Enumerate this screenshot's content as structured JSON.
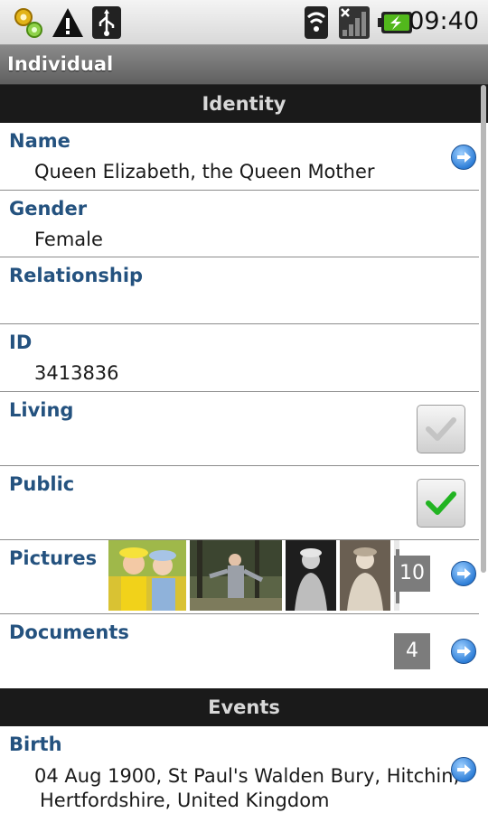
{
  "status_bar": {
    "time": "09:40",
    "icons": [
      "settings-gear-icon",
      "warning-icon",
      "usb-icon",
      "wifi-icon",
      "no-signal-icon",
      "battery-charging-icon"
    ]
  },
  "app_title": "Individual",
  "sections": {
    "identity": "Identity",
    "events": "Events"
  },
  "fields": {
    "name": {
      "label": "Name",
      "value": "Queen Elizabeth, the Queen Mother"
    },
    "gender": {
      "label": "Gender",
      "value": "Female"
    },
    "relationship": {
      "label": "Relationship",
      "value": ""
    },
    "id": {
      "label": "ID",
      "value": "3413836"
    },
    "living": {
      "label": "Living",
      "checked": true,
      "enabled": false
    },
    "public": {
      "label": "Public",
      "checked": true,
      "enabled": true
    },
    "pictures": {
      "label": "Pictures",
      "count": "10"
    },
    "documents": {
      "label": "Documents",
      "count": "4"
    }
  },
  "events": {
    "birth": {
      "label": "Birth",
      "value_line1": "04 Aug 1900, St Paul's Walden Bury, Hitchin,",
      "value_line2": "Hertfordshire, United Kingdom"
    }
  },
  "colors": {
    "label": "#24527f",
    "section_header_bg": "#1a1a1a",
    "check_green": "#22b422"
  }
}
